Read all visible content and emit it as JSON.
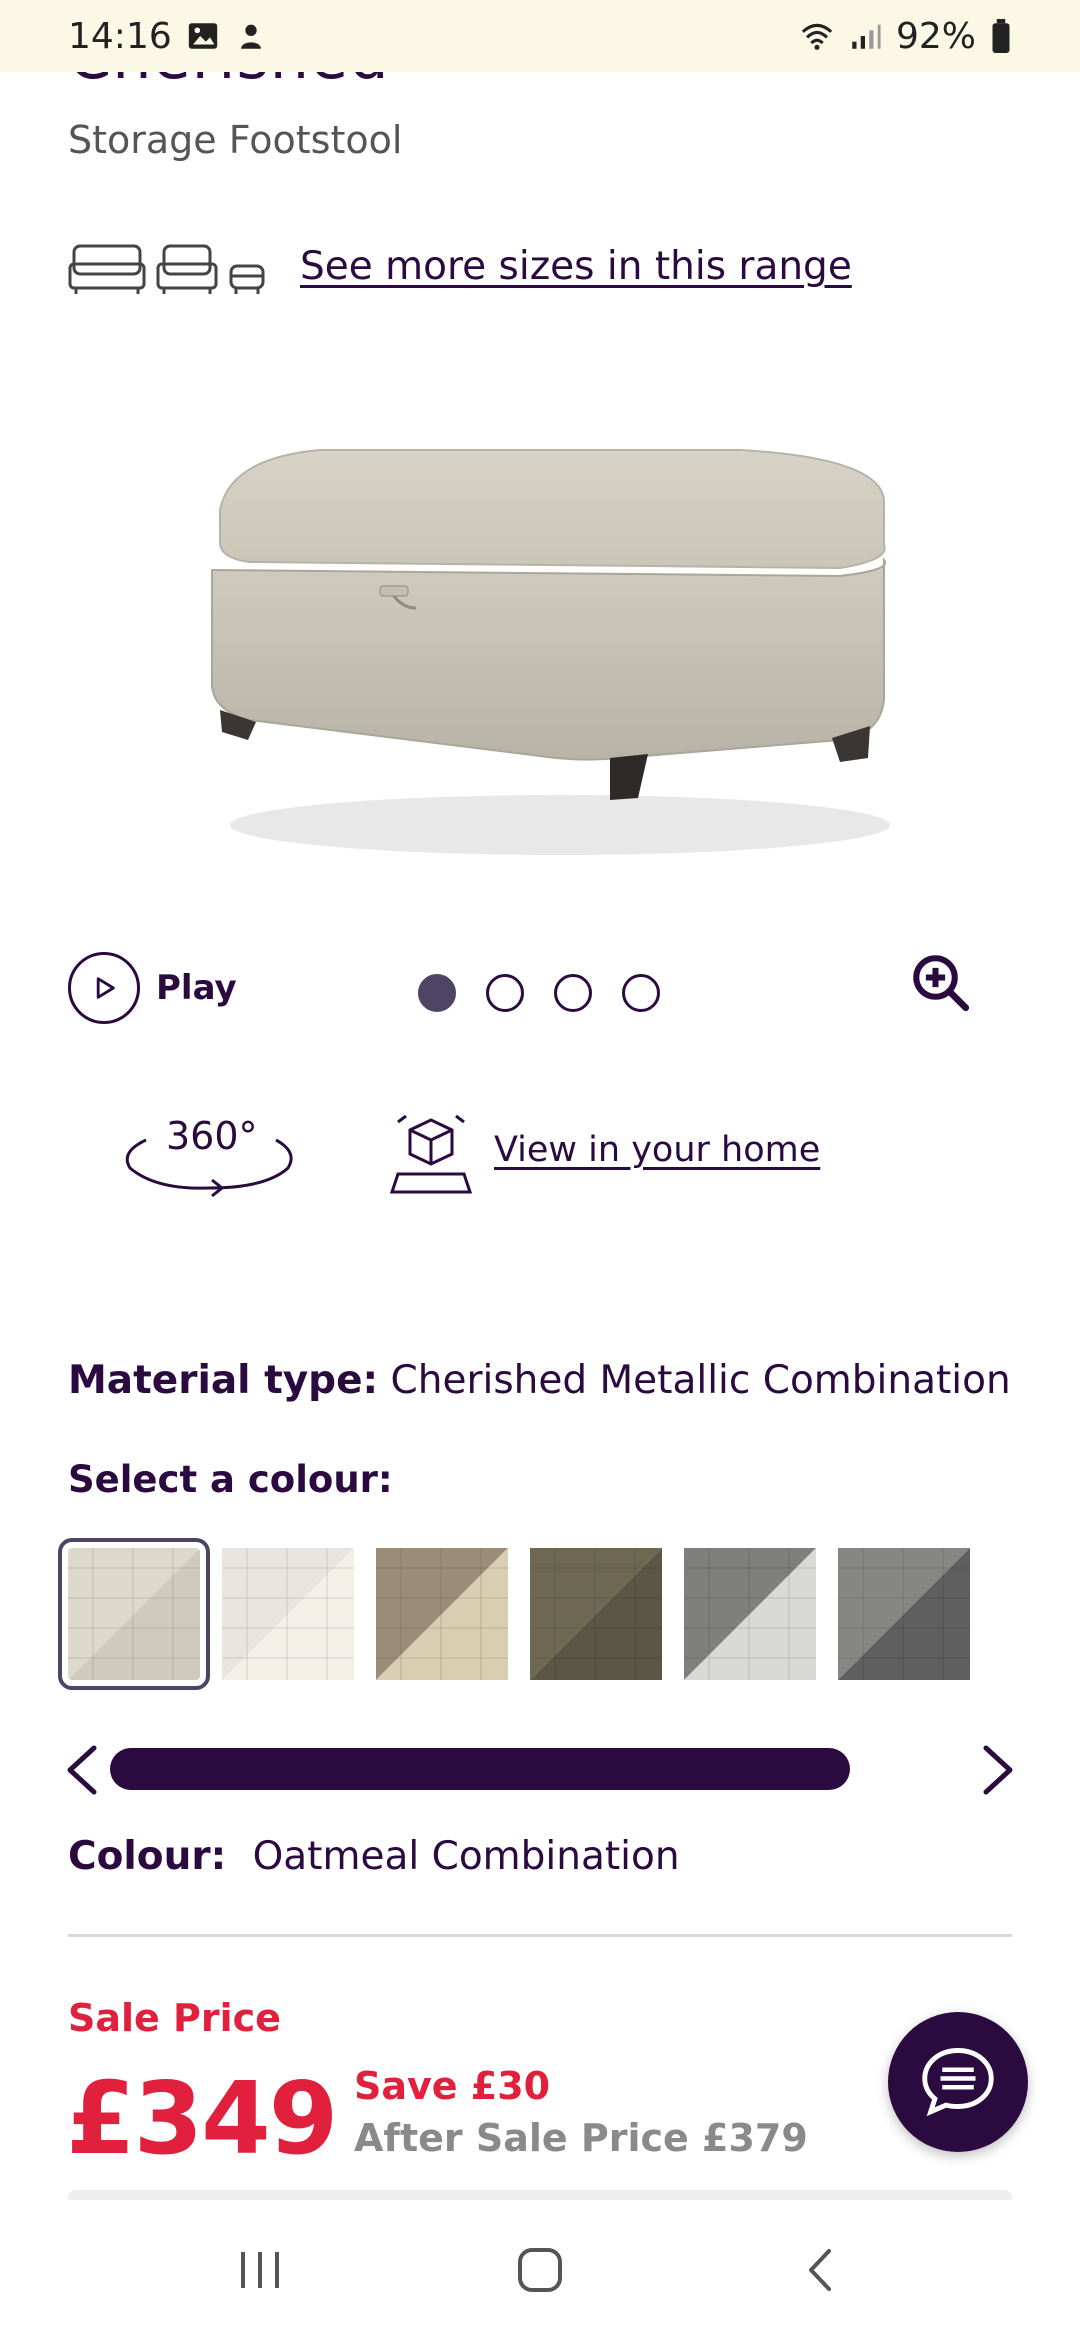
{
  "status_bar": {
    "time": "14:16",
    "battery": "92%"
  },
  "product": {
    "title_partial": "Cherished",
    "subtitle": "Storage Footstool"
  },
  "sizes": {
    "link_label": "See more sizes in this range"
  },
  "gallery": {
    "play_label": "Play",
    "dots_total": 4,
    "active_dot": 1
  },
  "view_360_label": "360°",
  "ar_link_label": "View in your home",
  "material": {
    "label": "Material type:",
    "value": "Cherished Metallic Combination"
  },
  "select_colour_label": "Select a colour:",
  "swatches": [
    {
      "name": "swatch-oatmeal-combination",
      "a": "#dcd8cc",
      "b": "#cfcabd",
      "selected": true
    },
    {
      "name": "swatch-cream-combination",
      "a": "#e8e5df",
      "b": "#f3f0e8",
      "selected": false
    },
    {
      "name": "swatch-mink-combination",
      "a": "#9b8c78",
      "b": "#d9cdb2",
      "selected": false
    },
    {
      "name": "swatch-olive-combination",
      "a": "#6e6853",
      "b": "#5b5646",
      "selected": false
    },
    {
      "name": "swatch-silver-combination",
      "a": "#7f7f7d",
      "b": "#d8d8d6",
      "selected": false
    },
    {
      "name": "swatch-charcoal-combination",
      "a": "#868684",
      "b": "#5e5f5e",
      "selected": false
    }
  ],
  "colour": {
    "label": "Colour:",
    "value": "Oatmeal Combination"
  },
  "pricing": {
    "sale_label": "Sale Price",
    "price": "£349",
    "save": "Save £30",
    "after_sale": "After Sale Price £379"
  },
  "colors": {
    "brand": "#2a0a3f",
    "sale": "#e0203c"
  }
}
